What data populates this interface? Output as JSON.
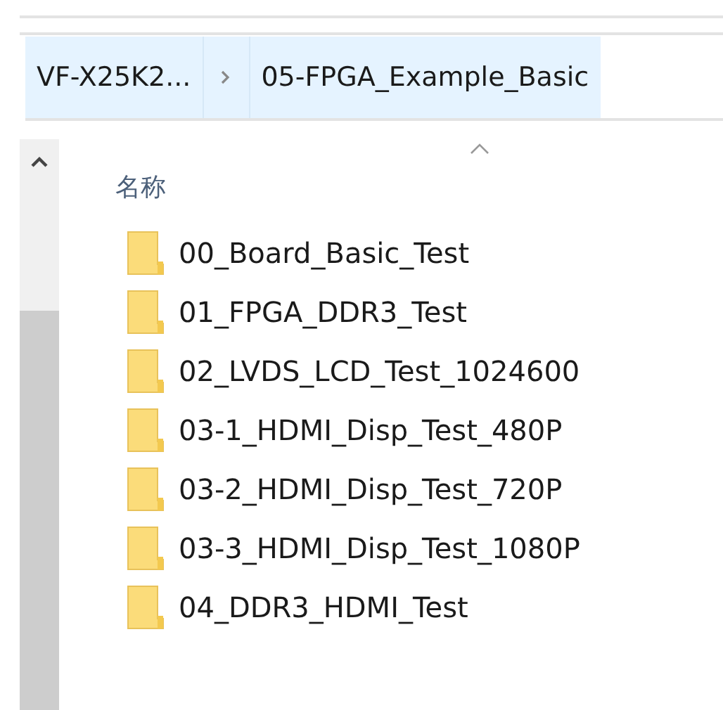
{
  "breadcrumb": [
    {
      "label": "VF-X25K2..."
    },
    {
      "label": "05-FPGA_Example_Basic"
    }
  ],
  "column_header": {
    "label": "名称",
    "sorted": true
  },
  "files": [
    {
      "name": "00_Board_Basic_Test"
    },
    {
      "name": "01_FPGA_DDR3_Test"
    },
    {
      "name": "02_LVDS_LCD_Test_1024600"
    },
    {
      "name": "03-1_HDMI_Disp_Test_480P"
    },
    {
      "name": "03-2_HDMI_Disp_Test_720P"
    },
    {
      "name": "03-3_HDMI_Disp_Test_1080P"
    },
    {
      "name": "04_DDR3_HDMI_Test"
    }
  ]
}
